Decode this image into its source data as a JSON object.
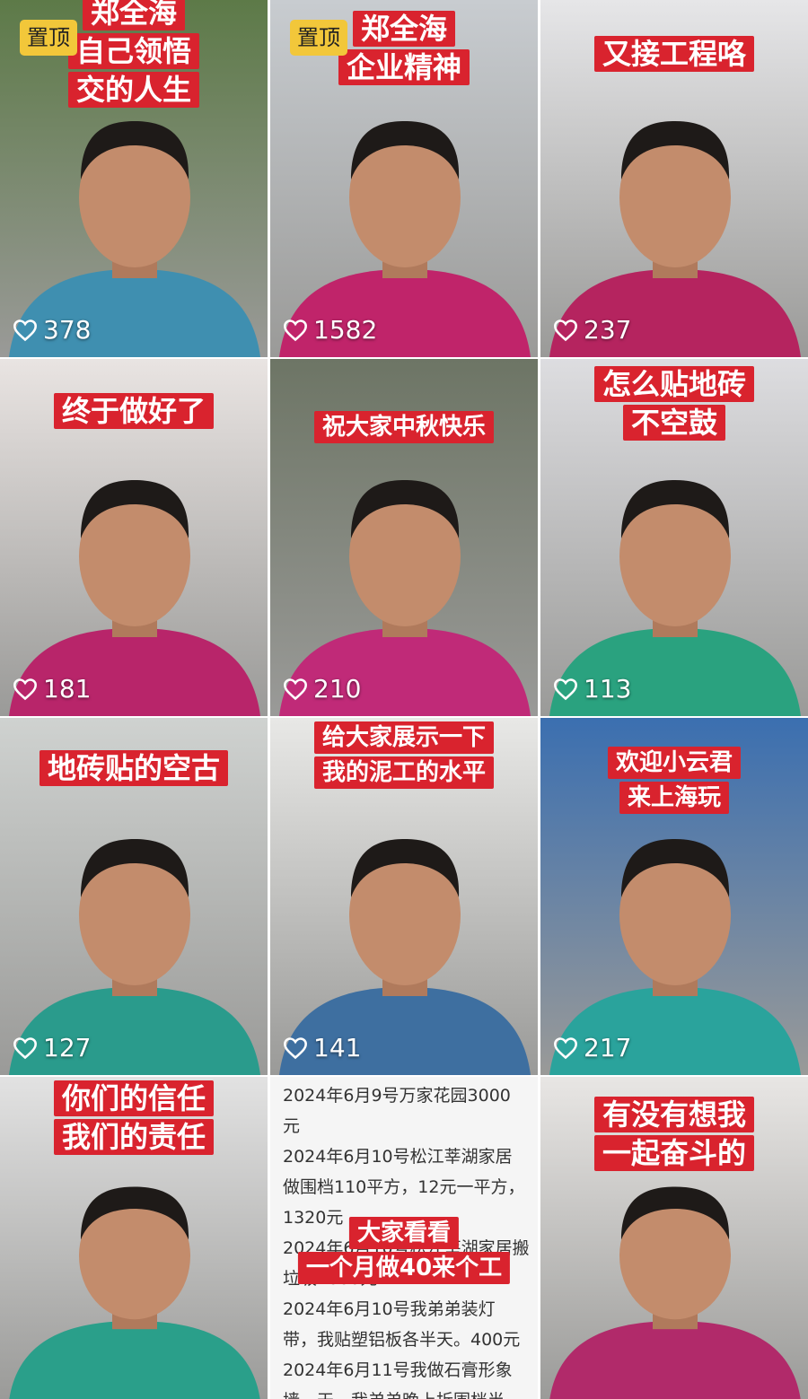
{
  "tiles": [
    {
      "caption": [
        "郑全海",
        "自己领悟",
        "交的人生"
      ],
      "pinned": true,
      "pin_label": "置顶",
      "likes": "378",
      "shirt": "#3f8fb0",
      "bg": "#5d7a48"
    },
    {
      "caption": [
        "郑全海",
        "企业精神"
      ],
      "pinned": true,
      "pin_label": "置顶",
      "likes": "1582",
      "shirt": "#c0246a",
      "bg": "#c8ccd0"
    },
    {
      "caption": [
        "又接工程咯"
      ],
      "pinned": false,
      "likes": "237",
      "shirt": "#b5245f",
      "bg": "#e6e6e8"
    },
    {
      "caption": [
        "终于做好了"
      ],
      "pinned": false,
      "likes": "181",
      "shirt": "#b8256a",
      "bg": "#e9e4e2"
    },
    {
      "caption": [
        "祝大家中秋快乐"
      ],
      "pinned": false,
      "likes": "210",
      "shirt": "#c02a78",
      "bg": "#6d7565"
    },
    {
      "caption": [
        "怎么贴地砖",
        "不空鼓"
      ],
      "pinned": false,
      "likes": "113",
      "shirt": "#2aa27f",
      "bg": "#dddde0"
    },
    {
      "caption": [
        "地砖贴的空古"
      ],
      "pinned": false,
      "likes": "127",
      "shirt": "#2a9b8c",
      "bg": "#cfd2d0"
    },
    {
      "caption": [
        "给大家展示一下",
        "我的泥工的水平"
      ],
      "pinned": false,
      "likes": "141",
      "shirt": "#3e6fa0",
      "bg": "#e8e8e6"
    },
    {
      "caption": [
        "欢迎小云君",
        "来上海玩"
      ],
      "pinned": false,
      "likes": "217",
      "shirt": "#2aa39c",
      "bg": "#3b6fb0"
    },
    {
      "caption": [
        "你们的信任",
        "我们的责任"
      ],
      "pinned": false,
      "likes": "",
      "shirt": "#2a9f8a",
      "bg": "#e2e2e2"
    },
    {
      "caption": [
        "大家看看",
        "一个月做40来个工"
      ],
      "pinned": false,
      "likes": "",
      "doc_lines": [
        "2024年6月9号万家花园3000",
        "元",
        "2024年6月10号松江莘湖家居",
        "做围档110平方，12元一平方，",
        "1320元",
        "2024年6月10号松江莘湖家居搬",
        "垃圾1000元",
        "2024年6月10号我弟弟装灯",
        "带，我贴塑铝板各半天。400元",
        "2024年6月11号我做石膏形象",
        "墙一天，我弟弟晚上拆围档半"
      ]
    },
    {
      "caption": [
        "有没有想我",
        "一起奋斗的"
      ],
      "pinned": false,
      "likes": "",
      "shirt": "#b12a6a",
      "bg": "#e8e6e4"
    }
  ],
  "icons": {
    "like": "heart-outline-icon"
  }
}
